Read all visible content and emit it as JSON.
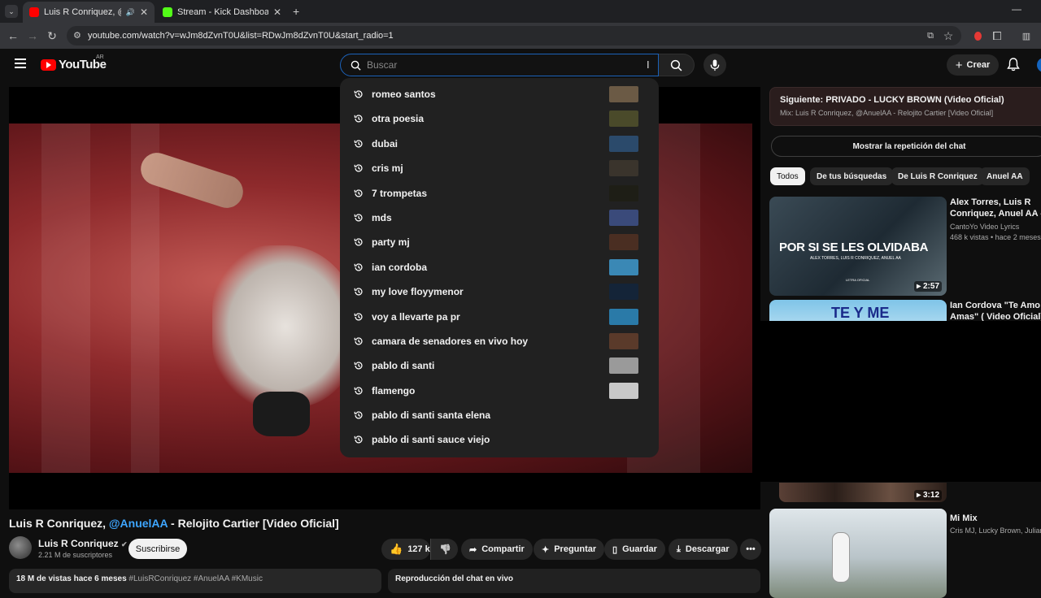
{
  "browser": {
    "tabs": [
      {
        "title": "Luis R Conriquez, @AnuelA",
        "favicon_color": "#ff0000",
        "active": true
      },
      {
        "title": "Stream - Kick Dashboard",
        "favicon_color": "#53fc18",
        "active": false
      }
    ],
    "url": "youtube.com/watch?v=wJm8dZvnT0U&list=RDwJm8dZvnT0U&start_radio=1"
  },
  "header": {
    "logo_text": "YouTube",
    "country_code": "AR",
    "search_placeholder": "Buscar",
    "create_label": "Crear"
  },
  "suggestions": [
    {
      "text": "romeo santos",
      "thumb_color": "#6b5a45"
    },
    {
      "text": "otra poesia",
      "thumb_color": "#4a4a2a"
    },
    {
      "text": "dubai",
      "thumb_color": "#2b4a6b"
    },
    {
      "text": "cris mj",
      "thumb_color": "#3a342c"
    },
    {
      "text": "7 trompetas",
      "thumb_color": "#1e1e16"
    },
    {
      "text": "mds",
      "thumb_color": "#3a4a7a"
    },
    {
      "text": "party mj",
      "thumb_color": "#4a2e22"
    },
    {
      "text": "ian cordoba",
      "thumb_color": "#3a88b5"
    },
    {
      "text": "my love floyymenor",
      "thumb_color": "#142438"
    },
    {
      "text": "voy a llevarte pa pr",
      "thumb_color": "#2a7aa8"
    },
    {
      "text": "camara de senadores en vivo hoy",
      "thumb_color": "#5a3a2a"
    },
    {
      "text": "pablo di santi",
      "thumb_color": "#9a9a9a"
    },
    {
      "text": "flamengo",
      "thumb_color": "#c8c8c8"
    },
    {
      "text": "pablo di santi santa elena",
      "thumb_color": ""
    },
    {
      "text": "pablo di santi sauce viejo",
      "thumb_color": ""
    }
  ],
  "video": {
    "title_prefix": "Luis R Conriquez, ",
    "title_mention": "@AnuelAA",
    "title_suffix": " - Relojito Cartier [Video Oficial]",
    "channel": "Luis R Conriquez",
    "subscribers": "2.21 M de suscriptores",
    "subscribe_label": "Suscribirse",
    "likes": "127 k",
    "share_label": "Compartir",
    "ask_label": "Preguntar",
    "save_label": "Guardar",
    "download_label": "Descargar",
    "views_date": "18 M de vistas  hace 6 meses",
    "hashtags": "#LuisRConriquez #AnuelAA #KMusic",
    "chat_replay_label": "Reproducción del chat en vivo"
  },
  "sidebar": {
    "next_title": "Siguiente: PRIVADO - LUCKY BROWN (Video Oficial)",
    "next_subtitle": "Mix: Luis R Conriquez, @AnuelAA - Relojito Cartier [Video Oficial]",
    "show_chat_label": "Mostrar la repetición del chat",
    "chips": [
      "Todos",
      "De tus búsquedas",
      "De Luis R Conriquez",
      "Anuel AA"
    ],
    "videos": [
      {
        "title_line1": "Alex Torres, Luis R",
        "title_line2": "Conriquez, Anuel AA - Por",
        "channel": "CantoYo Video Lyrics",
        "meta": "468 k vistas • hace 2 meses",
        "duration": "2:57",
        "thumb_text": "POR SI SE LES OLVIDABA",
        "thumb_sub": "ALEX TORRES, LUIS R CONRIQUEZ, ANUEL AA",
        "thumb_tag": "LETRA OFICIAL"
      },
      {
        "title_line1": "Ian Cordova \"Te Amo y Me",
        "title_line2": "Amas\" ( Video Oficial)",
        "thumb_text": "TE Y ME"
      },
      {
        "duration": "3:12"
      },
      {
        "title_line1": "Mi Mix",
        "channel": "Cris MJ, Lucky Brown, Julianno"
      }
    ]
  },
  "colors": {
    "accent_blue": "#3ea6ff",
    "youtube_red": "#ff0000",
    "background": "#0f0f0f"
  }
}
